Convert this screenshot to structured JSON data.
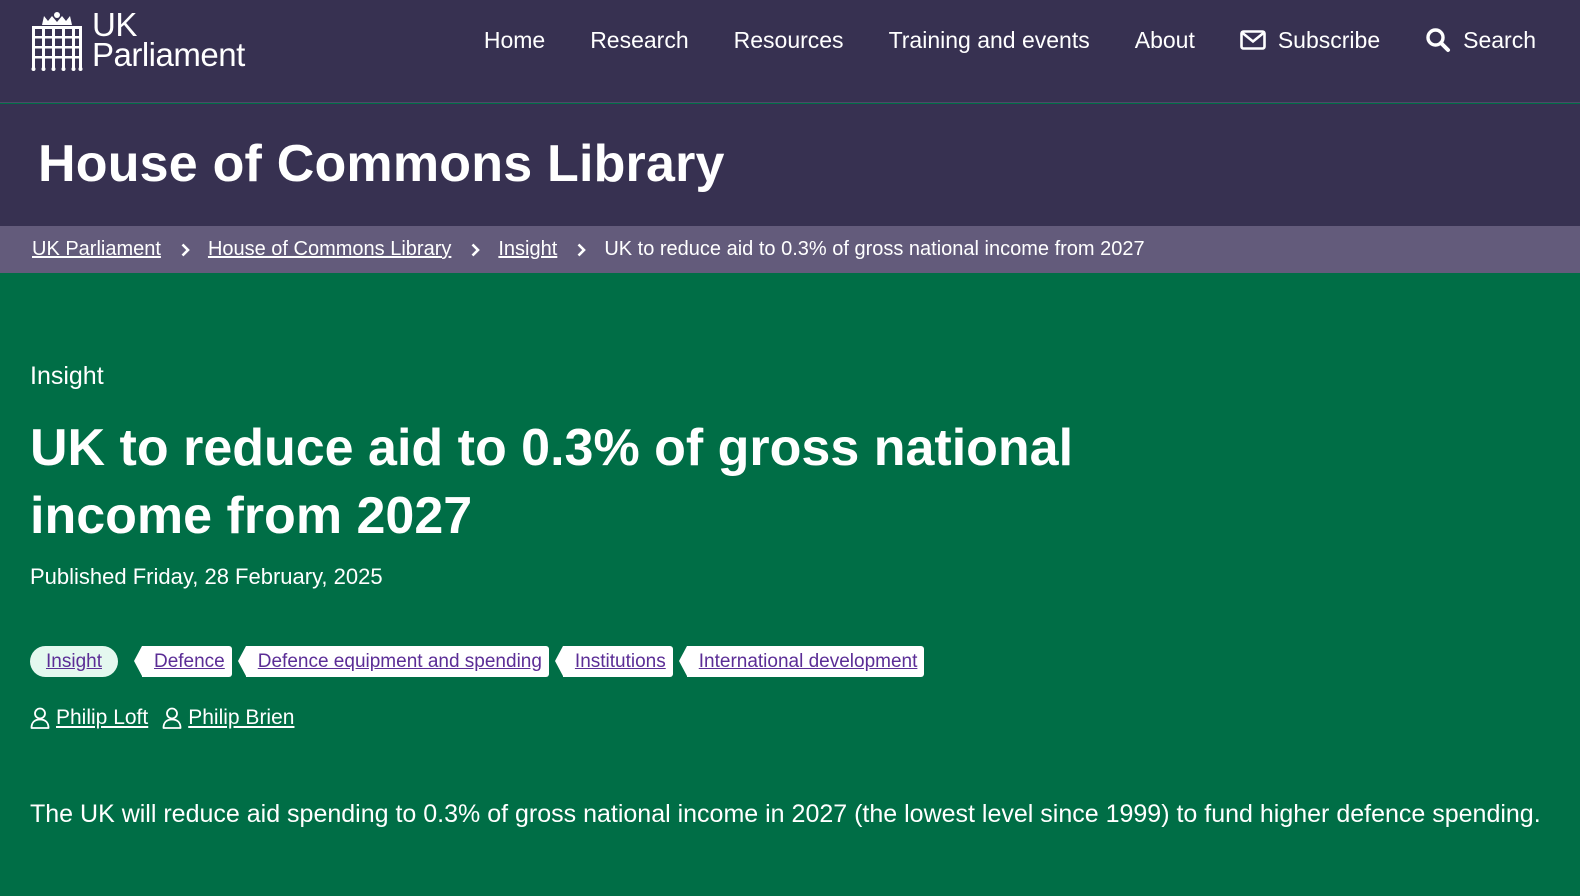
{
  "nav": {
    "logo_line1": "UK",
    "logo_line2": "Parliament",
    "logo_icon": "portcullis-icon",
    "links": [
      {
        "label": "Home"
      },
      {
        "label": "Research"
      },
      {
        "label": "Resources"
      },
      {
        "label": "Training and events"
      },
      {
        "label": "About"
      },
      {
        "label": "Subscribe",
        "icon": "envelope-icon"
      },
      {
        "label": "Search",
        "icon": "search-icon"
      }
    ]
  },
  "header": {
    "title": "House of Commons Library"
  },
  "breadcrumb": {
    "items": [
      {
        "label": "UK Parliament"
      },
      {
        "label": "House of Commons Library"
      },
      {
        "label": "Insight"
      }
    ],
    "current": "UK to reduce aid to 0.3% of gross national income from 2027"
  },
  "article": {
    "eyebrow": "Insight",
    "title": "UK to reduce aid to 0.3% of gross national income from 2027",
    "published": "Published Friday, 28 February, 2025",
    "tags": [
      {
        "label": "Insight"
      },
      {
        "label": "Defence"
      },
      {
        "label": "Defence equipment and spending"
      },
      {
        "label": "Institutions"
      },
      {
        "label": "International development"
      }
    ],
    "authors": [
      {
        "name": "Philip Loft",
        "icon": "person-icon"
      },
      {
        "name": "Philip Brien",
        "icon": "person-icon"
      }
    ],
    "lede": "The UK will reduce aid spending to 0.3% of gross national income in 2027 (the lowest level since 1999) to fund higher defence spending."
  },
  "colors": {
    "nav_bg": "#373151",
    "breadcrumb_bg": "#635b7b",
    "main_bg": "#006e46",
    "tag_text": "#5b2d96",
    "pill_bg": "#e4f8ef"
  }
}
